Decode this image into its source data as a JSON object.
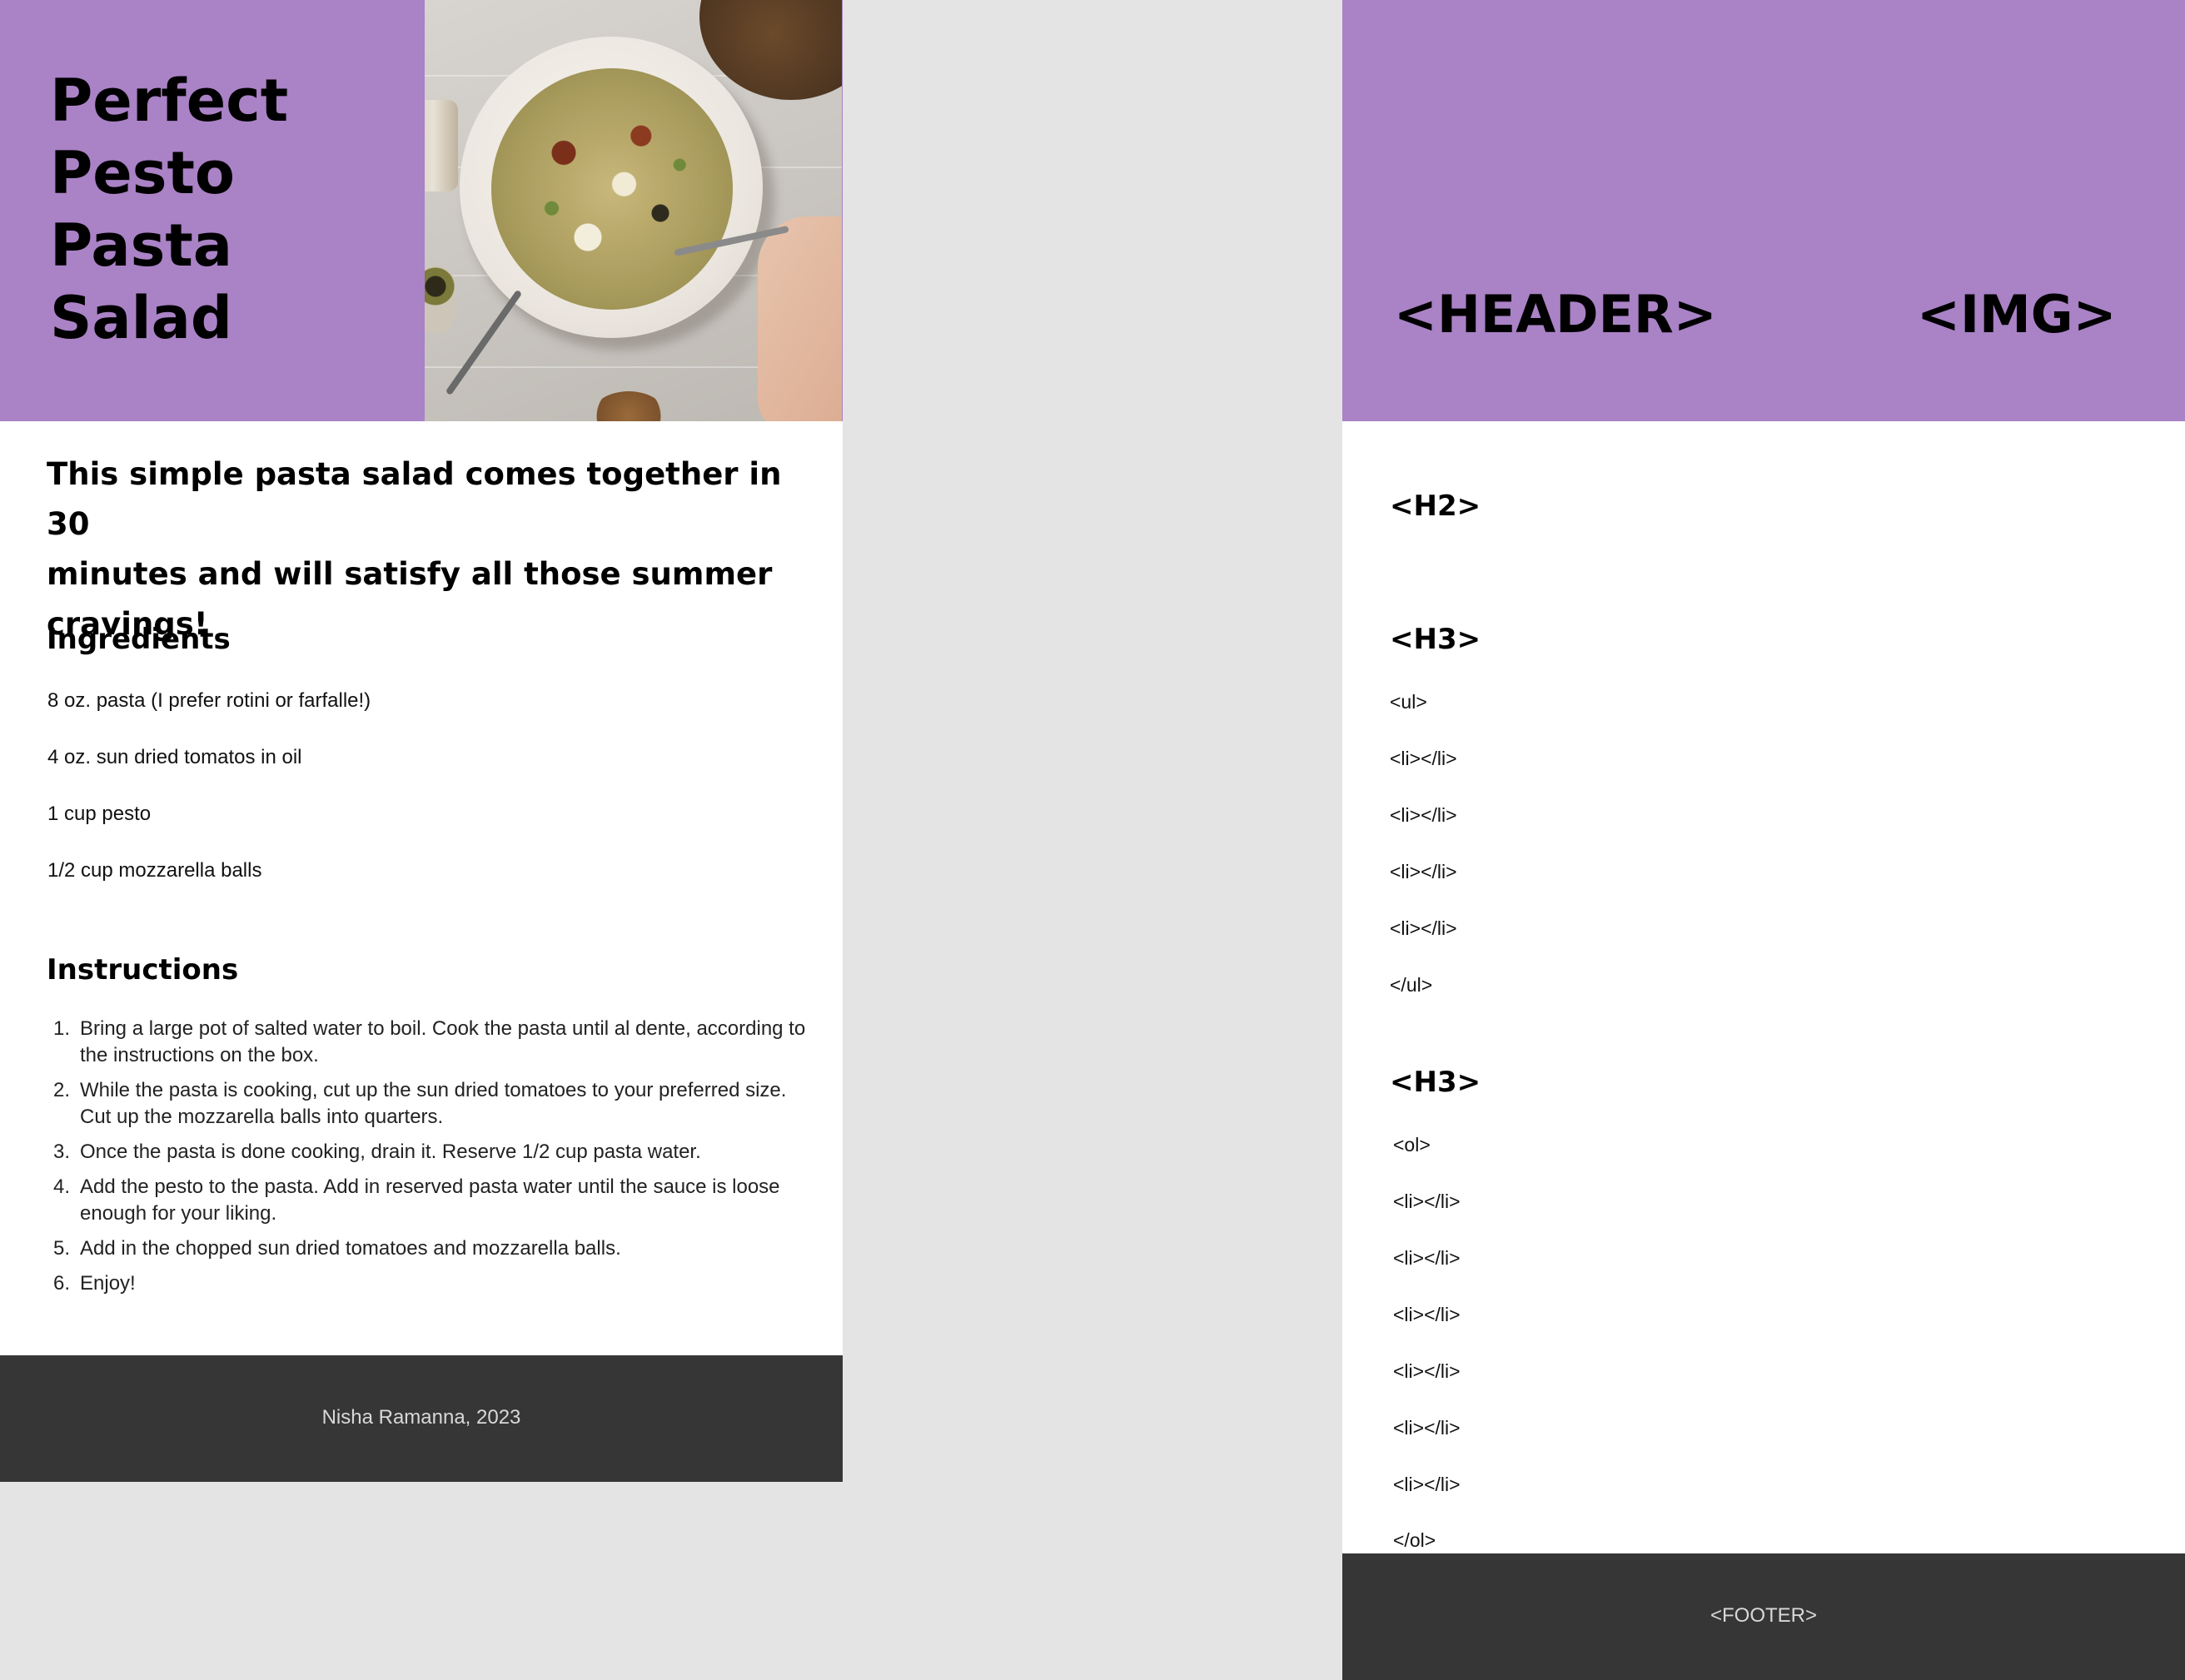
{
  "recipe": {
    "title_lines": [
      "Perfect",
      "Pesto",
      "Pasta",
      "Salad"
    ],
    "hero_image_icon": "pesto-pasta-bowl-photo",
    "intro_lines": [
      "This simple pasta salad comes together in 30",
      "minutes and will satisfy all those summer",
      "cravings!"
    ],
    "ingredients_heading": "Ingredients",
    "ingredients": [
      "8 oz. pasta (I prefer rotini or farfalle!)",
      "4 oz. sun dried tomatos in oil",
      "1 cup pesto",
      "1/2 cup mozzarella balls"
    ],
    "instructions_heading": "Instructions",
    "instructions": [
      {
        "num": "1.",
        "text": "Bring a large pot of salted water to boil. Cook the pasta until al dente, according to the instructions on the box."
      },
      {
        "num": "2.",
        "text": "While the pasta is cooking, cut up the sun dried tomatoes to your preferred size. Cut up the mozzarella balls into quarters."
      },
      {
        "num": "3.",
        "text": "Once the pasta is done cooking, drain it. Reserve 1/2 cup pasta water."
      },
      {
        "num": "4.",
        "text": "Add the pesto to the pasta. Add in reserved pasta water until the sauce is loose enough for your liking."
      },
      {
        "num": "5.",
        "text": "Add in the chopped sun dried tomatoes and mozzarella balls."
      },
      {
        "num": "6.",
        "text": "Enjoy!"
      }
    ],
    "footer": "Nisha Ramanna, 2023"
  },
  "wireframe": {
    "header_label": "<HEADER>",
    "img_label": "<IMG>",
    "h2_label": "<H2>",
    "h3_ingredients_label": "<H3>",
    "ul_open": "<ul>",
    "ul_items": [
      "<li></li>",
      "<li></li>",
      "<li></li>",
      "<li></li>"
    ],
    "ul_close": "</ul>",
    "h3_instructions_label": "<H3>",
    "ol_open": "<ol>",
    "ol_items": [
      "<li></li>",
      "<li></li>",
      "<li></li>",
      "<li></li>",
      "<li></li>",
      "<li></li>"
    ],
    "ol_close": "</ol>",
    "footer_label": "<FOOTER>"
  },
  "colors": {
    "header_purple": "#aa82c6",
    "footer_dark": "#363636",
    "canvas_gray": "#e4e4e4"
  }
}
